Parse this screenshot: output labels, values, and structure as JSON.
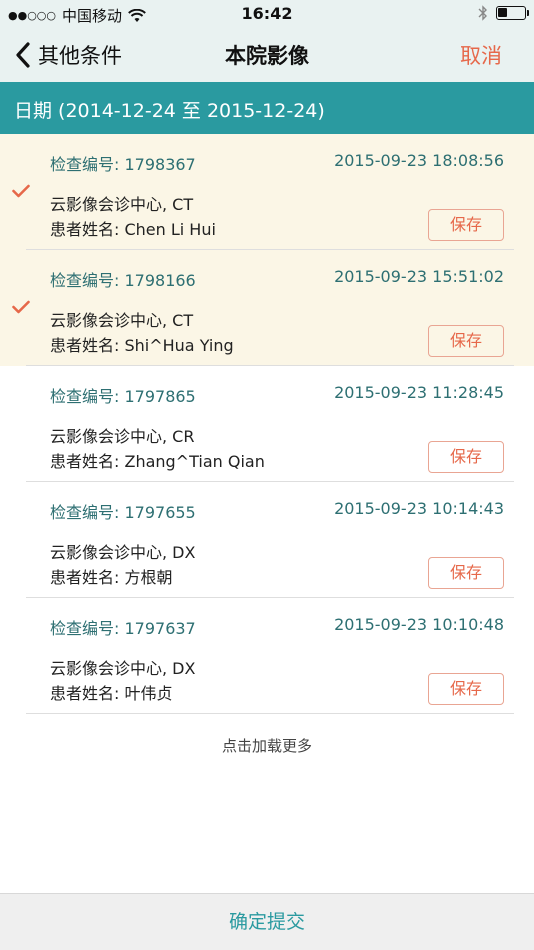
{
  "status_bar": {
    "signal": "●●○○○",
    "carrier": "中国移动",
    "time": "16:42",
    "battery_level": 0.35
  },
  "nav": {
    "back_label": "其他条件",
    "title": "本院影像",
    "cancel_label": "取消"
  },
  "date_range": "日期 (2014-12-24 至 2015-12-24)",
  "records": [
    {
      "exam_id": "检查编号: 1798367",
      "datetime": "2015-09-23 18:08:56",
      "center": "云影像会诊中心, CT",
      "patient": "患者姓名: Chen Li Hui",
      "save_label": "保存",
      "selected": true
    },
    {
      "exam_id": "检查编号: 1798166",
      "datetime": "2015-09-23 15:51:02",
      "center": "云影像会诊中心, CT",
      "patient": "患者姓名: Shi^Hua Ying",
      "save_label": "保存",
      "selected": true
    },
    {
      "exam_id": "检查编号: 1797865",
      "datetime": "2015-09-23 11:28:45",
      "center": "云影像会诊中心, CR",
      "patient": "患者姓名: Zhang^Tian Qian",
      "save_label": "保存",
      "selected": false
    },
    {
      "exam_id": "检查编号: 1797655",
      "datetime": "2015-09-23 10:14:43",
      "center": "云影像会诊中心, DX",
      "patient": "患者姓名: 方根朝",
      "save_label": "保存",
      "selected": false
    },
    {
      "exam_id": "检查编号: 1797637",
      "datetime": "2015-09-23 10:10:48",
      "center": "云影像会诊中心, DX",
      "patient": "患者姓名: 叶伟贞",
      "save_label": "保存",
      "selected": false
    }
  ],
  "load_more": "点击加载更多",
  "submit_label": "确定提交",
  "colors": {
    "accent": "#2a9aa0",
    "cancel": "#e6684a",
    "selected_bg": "#fbf6e6"
  }
}
